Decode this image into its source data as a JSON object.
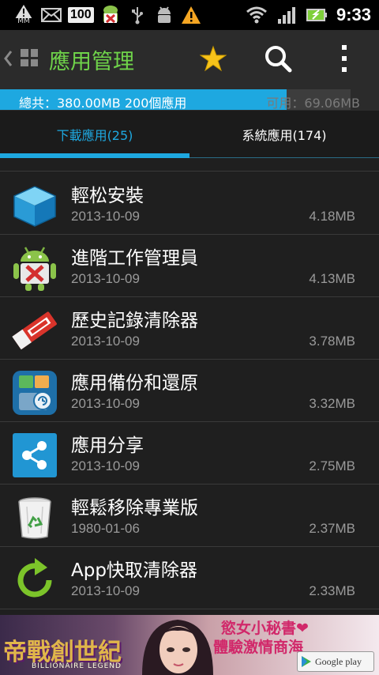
{
  "status_bar": {
    "mm_label": "MM",
    "badge": "100",
    "time": "9:33"
  },
  "action_bar": {
    "title": "應用管理",
    "title_color": "#6fd34a"
  },
  "storage": {
    "total_text": "總共：380.00MB  200個應用",
    "free_text": "可用：69.06MB",
    "used_fraction": 0.817,
    "bar_color": "#1ea8e0"
  },
  "tabs": [
    {
      "label": "下載應用(25)",
      "active": true
    },
    {
      "label": "系統應用(174)",
      "active": false
    }
  ],
  "apps": [
    {
      "name": "輕松安裝",
      "date": "2013-10-09",
      "size": "4.18MB",
      "icon": "blue-cube-icon"
    },
    {
      "name": "進階工作管理員",
      "date": "2013-10-09",
      "size": "4.13MB",
      "icon": "android-robot-x-icon"
    },
    {
      "name": "歷史記錄清除器",
      "date": "2013-10-09",
      "size": "3.78MB",
      "icon": "eraser-icon"
    },
    {
      "name": "應用備份和還原",
      "date": "2013-10-09",
      "size": "3.32MB",
      "icon": "backup-restore-icon"
    },
    {
      "name": "應用分享",
      "date": "2013-10-09",
      "size": "2.75MB",
      "icon": "share-icon"
    },
    {
      "name": "輕鬆移除專業版",
      "date": "1980-01-06",
      "size": "2.37MB",
      "icon": "recycle-bin-icon"
    },
    {
      "name": "App快取清除器",
      "date": "2013-10-09",
      "size": "2.33MB",
      "icon": "green-refresh-icon"
    }
  ],
  "ad": {
    "game_title": "帝戰創世紀",
    "game_subtitle": "BILLIONAIRE LEGEND",
    "line1": "慾女小秘書❤",
    "line2": "體驗激情商海",
    "store": "Google play"
  }
}
